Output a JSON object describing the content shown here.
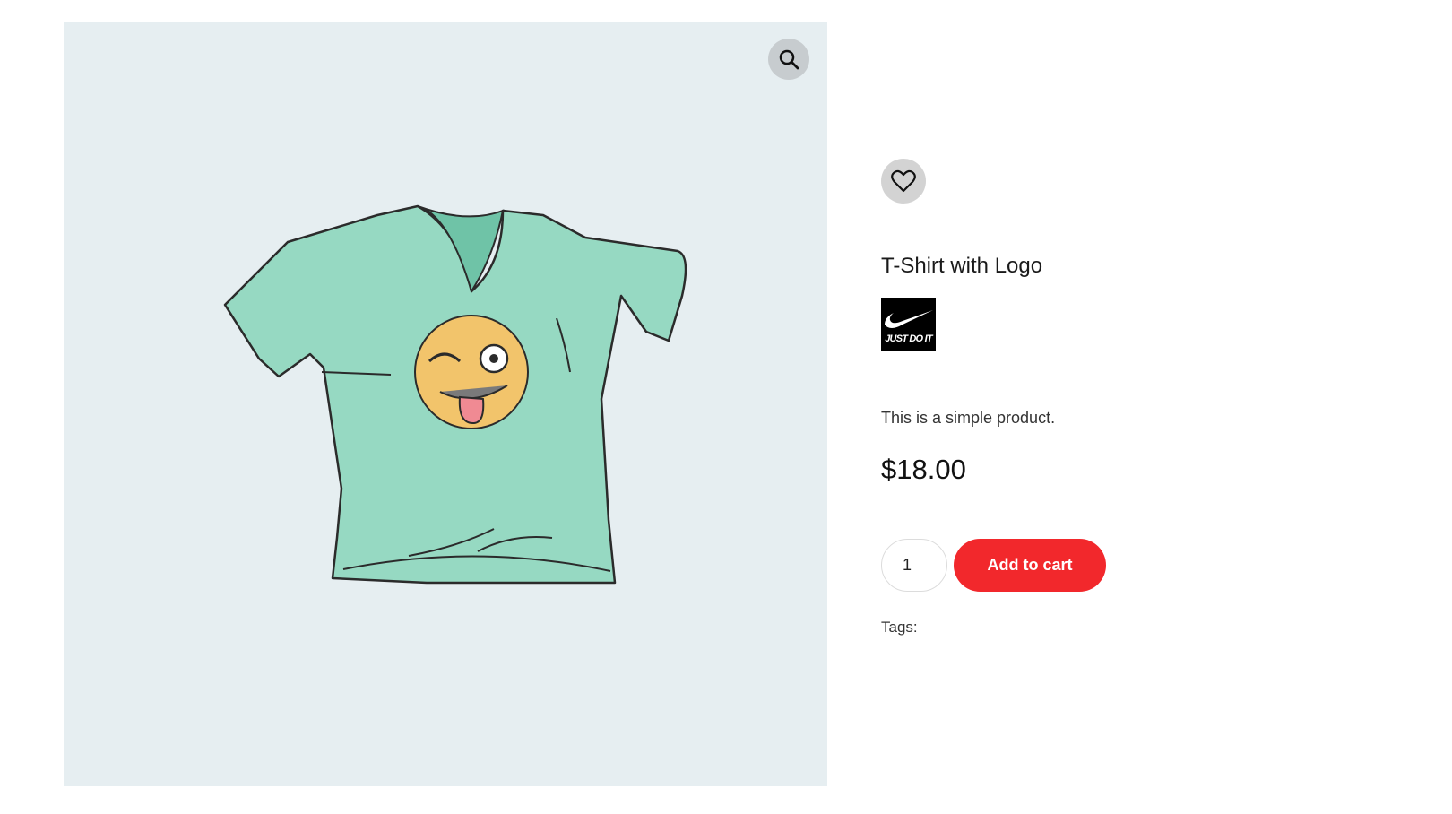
{
  "gallery": {
    "zoom_icon": "magnifier-icon",
    "image_alt": "T-Shirt with Logo",
    "background_color": "#e6eef1"
  },
  "product": {
    "wishlist_icon": "heart-icon",
    "title": "T-Shirt with Logo",
    "brand_logo_text": "JUST DO IT",
    "short_description": "This is a simple product.",
    "price": "$18.00",
    "quantity": "1",
    "add_to_cart_label": "Add to cart",
    "tags_label": "Tags:"
  },
  "colors": {
    "accent": "#f2282c",
    "shirt": "#8fd3bd",
    "emoji": "#f2c46b"
  }
}
